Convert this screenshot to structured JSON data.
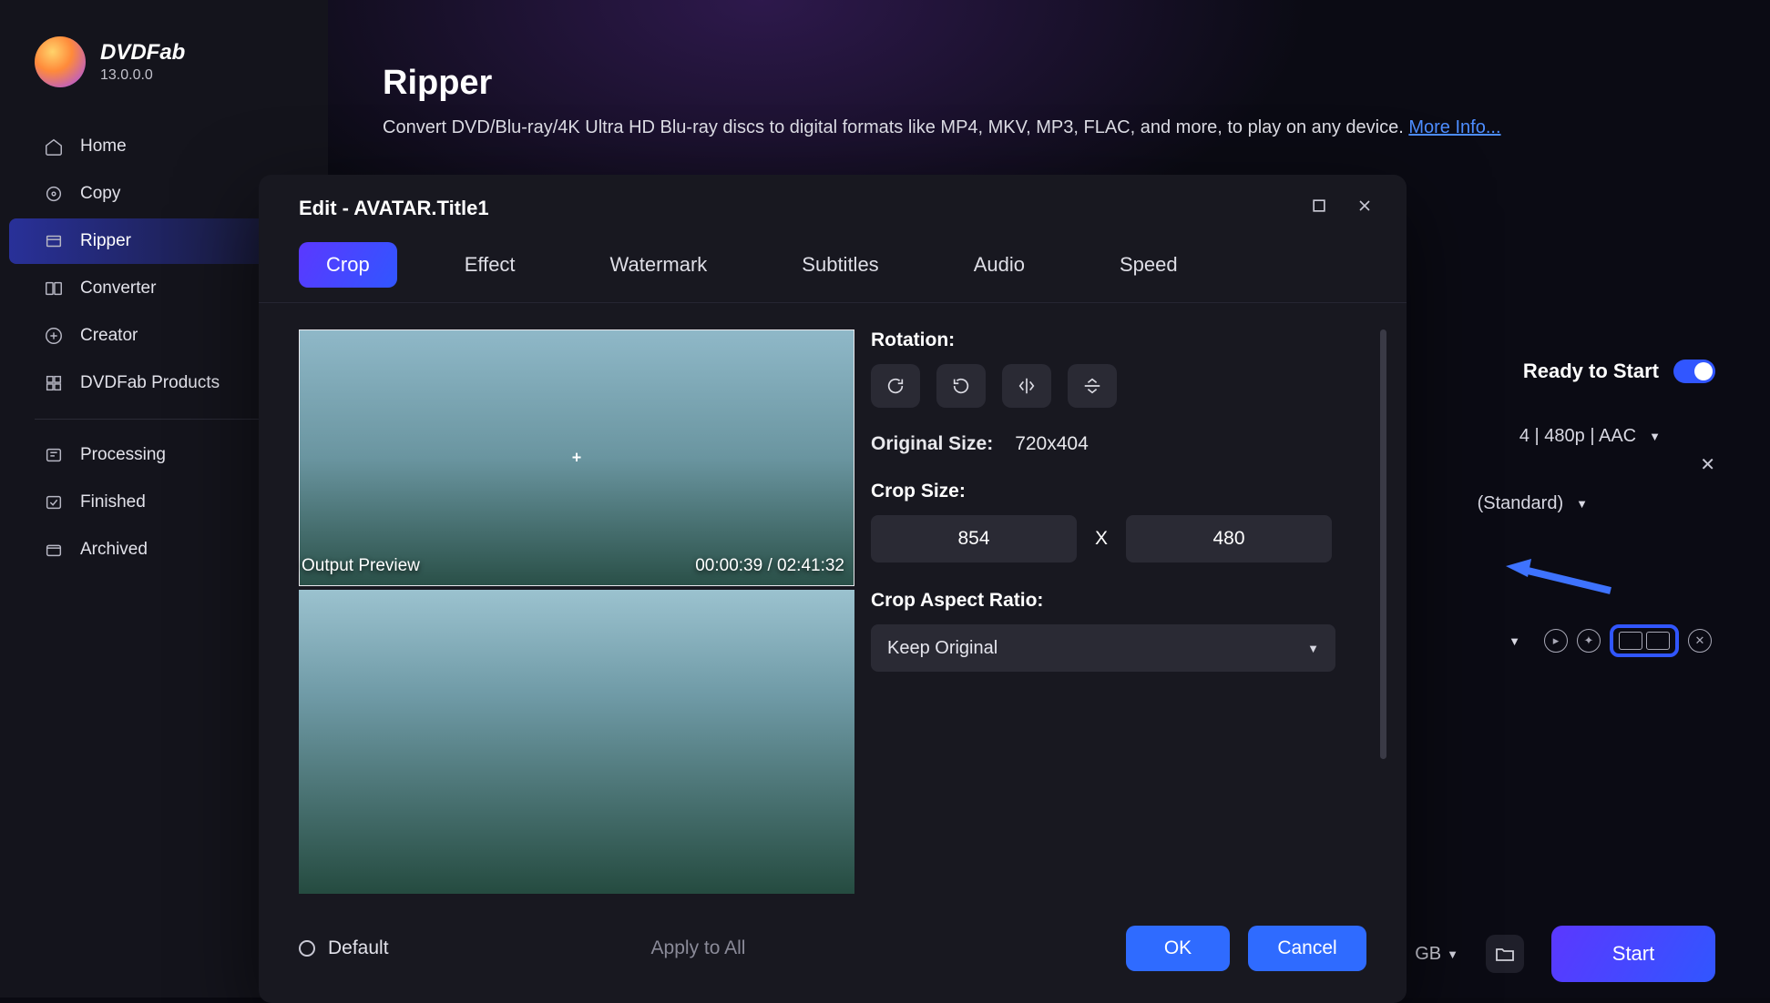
{
  "brand": {
    "name": "DVDFab",
    "version": "13.0.0.0"
  },
  "titlebar": {
    "gift": "gift-icon",
    "menu": "menu-icon",
    "minimize": "–",
    "maximize": "□",
    "close": "✕"
  },
  "sidebar": {
    "items": [
      {
        "key": "home",
        "label": "Home"
      },
      {
        "key": "copy",
        "label": "Copy"
      },
      {
        "key": "ripper",
        "label": "Ripper",
        "active": true
      },
      {
        "key": "converter",
        "label": "Converter"
      },
      {
        "key": "creator",
        "label": "Creator"
      },
      {
        "key": "products",
        "label": "DVDFab Products"
      }
    ],
    "queue": [
      {
        "key": "processing",
        "label": "Processing"
      },
      {
        "key": "finished",
        "label": "Finished"
      },
      {
        "key": "archived",
        "label": "Archived"
      }
    ]
  },
  "page": {
    "title": "Ripper",
    "description": "Convert DVD/Blu-ray/4K Ultra HD Blu-ray discs to digital formats like MP4, MKV, MP3, FLAC, and more, to play on any device.",
    "more_link": "More Info..."
  },
  "ready": {
    "label": "Ready to Start"
  },
  "profile_line": "4 | 480p | AAC",
  "preset_line": "(Standard)",
  "footer": {
    "size_unit": "GB",
    "start": "Start"
  },
  "modal": {
    "title": "Edit - AVATAR.Title1",
    "tabs": [
      {
        "key": "crop",
        "label": "Crop",
        "active": true
      },
      {
        "key": "effect",
        "label": "Effect"
      },
      {
        "key": "watermark",
        "label": "Watermark"
      },
      {
        "key": "subtitles",
        "label": "Subtitles"
      },
      {
        "key": "audio",
        "label": "Audio"
      },
      {
        "key": "speed",
        "label": "Speed"
      }
    ],
    "preview": {
      "label": "Output Preview",
      "time": "00:00:39 / 02:41:32"
    },
    "rotation_label": "Rotation:",
    "original_size_label": "Original Size:",
    "original_size_value": "720x404",
    "crop_size_label": "Crop Size:",
    "crop_w": "854",
    "crop_h": "480",
    "crop_x": "X",
    "aspect_label": "Crop Aspect Ratio:",
    "aspect_value": "Keep Original",
    "default_label": "Default",
    "apply_all_label": "Apply to All",
    "ok": "OK",
    "cancel": "Cancel"
  }
}
